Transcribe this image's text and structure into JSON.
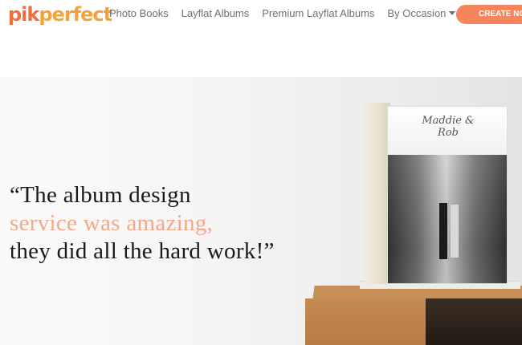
{
  "logo": {
    "part1": "pik",
    "part2": "perfect"
  },
  "nav": {
    "items": [
      {
        "label": "Photo Books"
      },
      {
        "label": "Layflat Albums"
      },
      {
        "label": "Premium Layflat Albums"
      },
      {
        "label": "By Occasion"
      }
    ]
  },
  "cta": {
    "label": "CREATE NOW"
  },
  "hero": {
    "quote_line1": "“The album design",
    "quote_line2": "service was amazing,",
    "quote_line3": "they did all the hard work!”",
    "album_cover_title": "Maddie & Rob"
  },
  "colors": {
    "brand_orange": "#f26d3d",
    "cta_background": "#f4855d",
    "quote_accent": "#f1a98a"
  }
}
